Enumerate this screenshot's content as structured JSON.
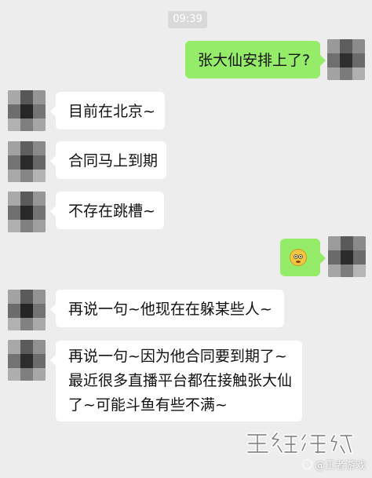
{
  "status_time": "09:39",
  "messages": [
    {
      "side": "right",
      "text": "张大仙安排上了?"
    },
    {
      "side": "left",
      "text": "目前在北京~"
    },
    {
      "side": "left",
      "text": "合同马上到期"
    },
    {
      "side": "left",
      "text": "不存在跳槽~"
    },
    {
      "side": "right",
      "emoji": "dizzy-face-emoji"
    },
    {
      "side": "left",
      "text": "再说一句~他现在在躲某些人~"
    },
    {
      "side": "left",
      "lines": [
        "再说一句~因为他合同要到期了~",
        "最近很多直播平台都在接触张大仙",
        "了~可能斗鱼有些不满~"
      ]
    }
  ],
  "watermark": {
    "brand": "王者游戏",
    "label": "@王者游戏"
  },
  "colors": {
    "background": "#ededed",
    "bubble_left": "#ffffff",
    "bubble_right": "#95ec69",
    "timestamp_bg": "#d9d9d9"
  },
  "icons": {
    "avatar": "avatar-icon",
    "emoji": "dizzy-face-emoji",
    "watermark": "brand-watermark-icon"
  }
}
